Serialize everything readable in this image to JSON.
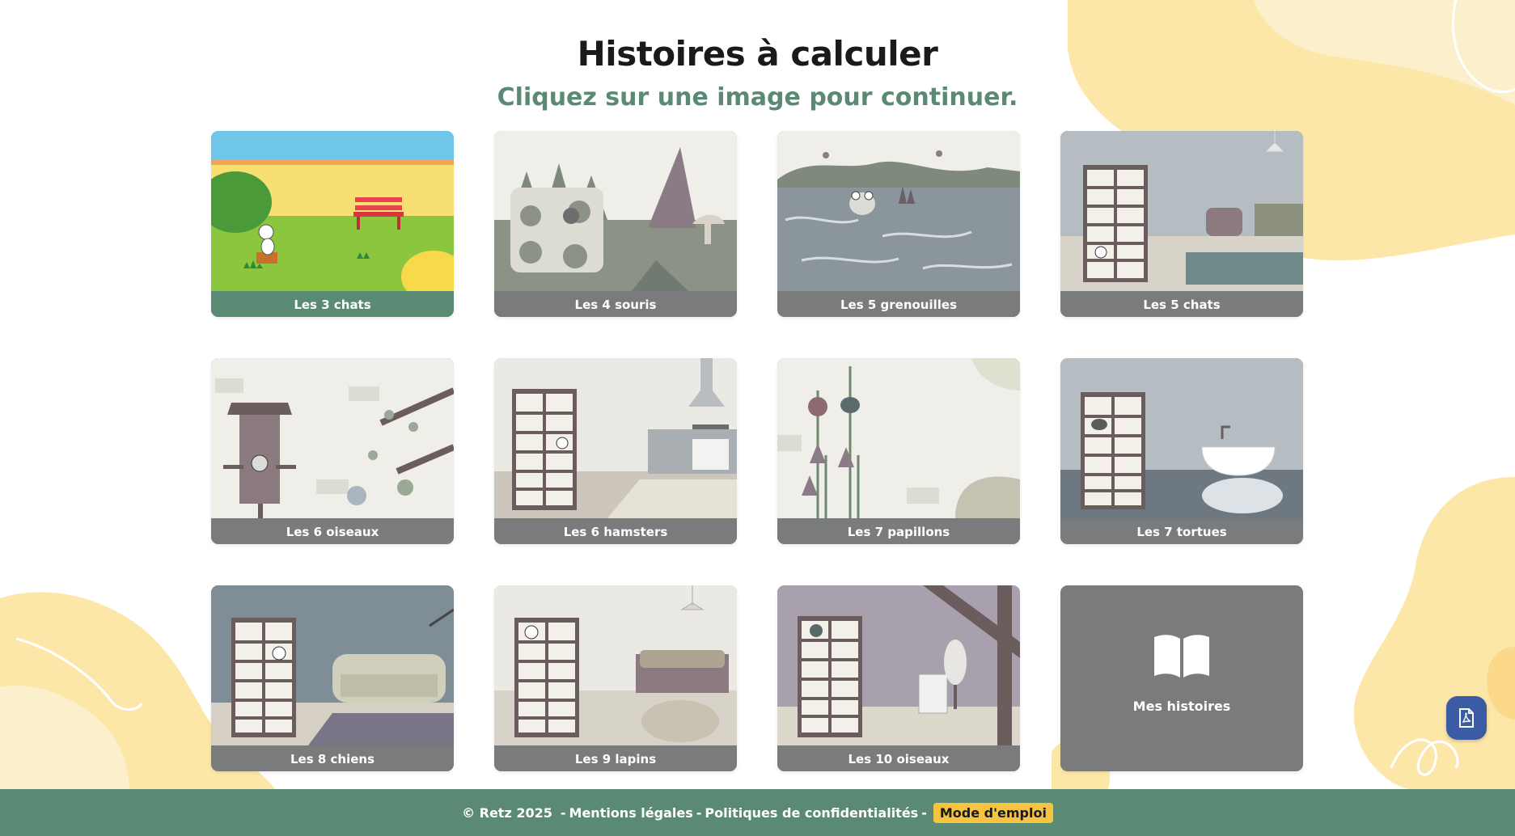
{
  "header": {
    "title": "Histoires à calculer",
    "subtitle": "Cliquez sur une image pour continuer."
  },
  "cards": [
    {
      "label": "Les 3 chats",
      "scene": "park-cat",
      "active": true
    },
    {
      "label": "Les 4 souris",
      "scene": "cheese-mouse"
    },
    {
      "label": "Les 5 grenouilles",
      "scene": "pond-frog"
    },
    {
      "label": "Les 5 chats",
      "scene": "room-shelf-cat"
    },
    {
      "label": "Les 6 oiseaux",
      "scene": "birdhouse"
    },
    {
      "label": "Les 6 hamsters",
      "scene": "kitchen-shelf-hamster"
    },
    {
      "label": "Les 7 papillons",
      "scene": "flowers-butterfly"
    },
    {
      "label": "Les 7 tortues",
      "scene": "bathroom-shelf-turtle"
    },
    {
      "label": "Les 8 chiens",
      "scene": "livingroom-shelf-dog"
    },
    {
      "label": "Les 9 lapins",
      "scene": "bedroom-shelf-rabbit"
    },
    {
      "label": "Les 10 oiseaux",
      "scene": "attic-shelf-bird"
    }
  ],
  "my_stories": {
    "label": "Mes histoires",
    "icon": "open-book-icon"
  },
  "pdf_button": {
    "icon": "pdf-file-icon"
  },
  "footer": {
    "copyright": "© Retz 2025",
    "sep1": "-",
    "legal": "Mentions légales",
    "sep2": "-",
    "privacy": "Politiques de confidentialités",
    "sep3": "-",
    "manual": "Mode d'emploi"
  },
  "colors": {
    "accent_green": "#5a8a74",
    "card_label_gray": "#797b7c",
    "blob_yellow": "#fde7a8",
    "button_blue": "#3b5ba5",
    "highlight_yellow": "#f6c342"
  }
}
